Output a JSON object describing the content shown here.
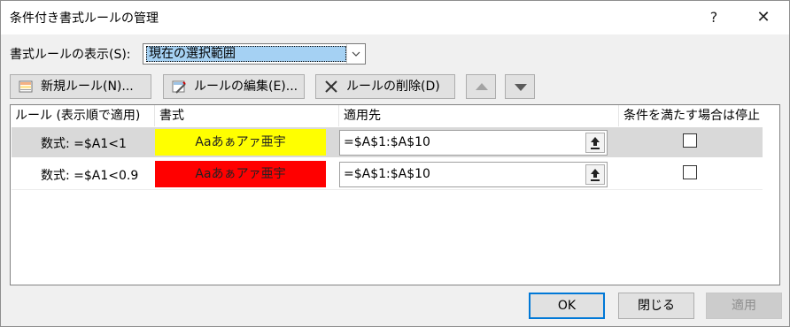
{
  "window": {
    "title": "条件付き書式ルールの管理",
    "help_glyph": "?",
    "close_glyph": "✕"
  },
  "scope": {
    "label": "書式ルールの表示(S):",
    "selected": "現在の選択範囲"
  },
  "toolbar": {
    "new_rule": "新規ルール(N)...",
    "edit_rule": "ルールの編集(E)...",
    "delete_rule": "ルールの削除(D)"
  },
  "table": {
    "headers": {
      "rule": "ルール (表示順で適用)",
      "format": "書式",
      "applies_to": "適用先",
      "stop_if_true": "条件を満たす場合は停止"
    },
    "rows": [
      {
        "rule": "数式: =$A1<1",
        "preview": "Aaあぁアァ亜宇",
        "preview_color": "#ffff00",
        "applies_to": "=$A$1:$A$10",
        "stop_if_true": false
      },
      {
        "rule": "数式: =$A1<0.9",
        "preview": "Aaあぁアァ亜宇",
        "preview_color": "#ff0000",
        "applies_to": "=$A$1:$A$10",
        "stop_if_true": false
      }
    ]
  },
  "footer": {
    "ok": "OK",
    "close": "閉じる",
    "apply": "適用"
  }
}
